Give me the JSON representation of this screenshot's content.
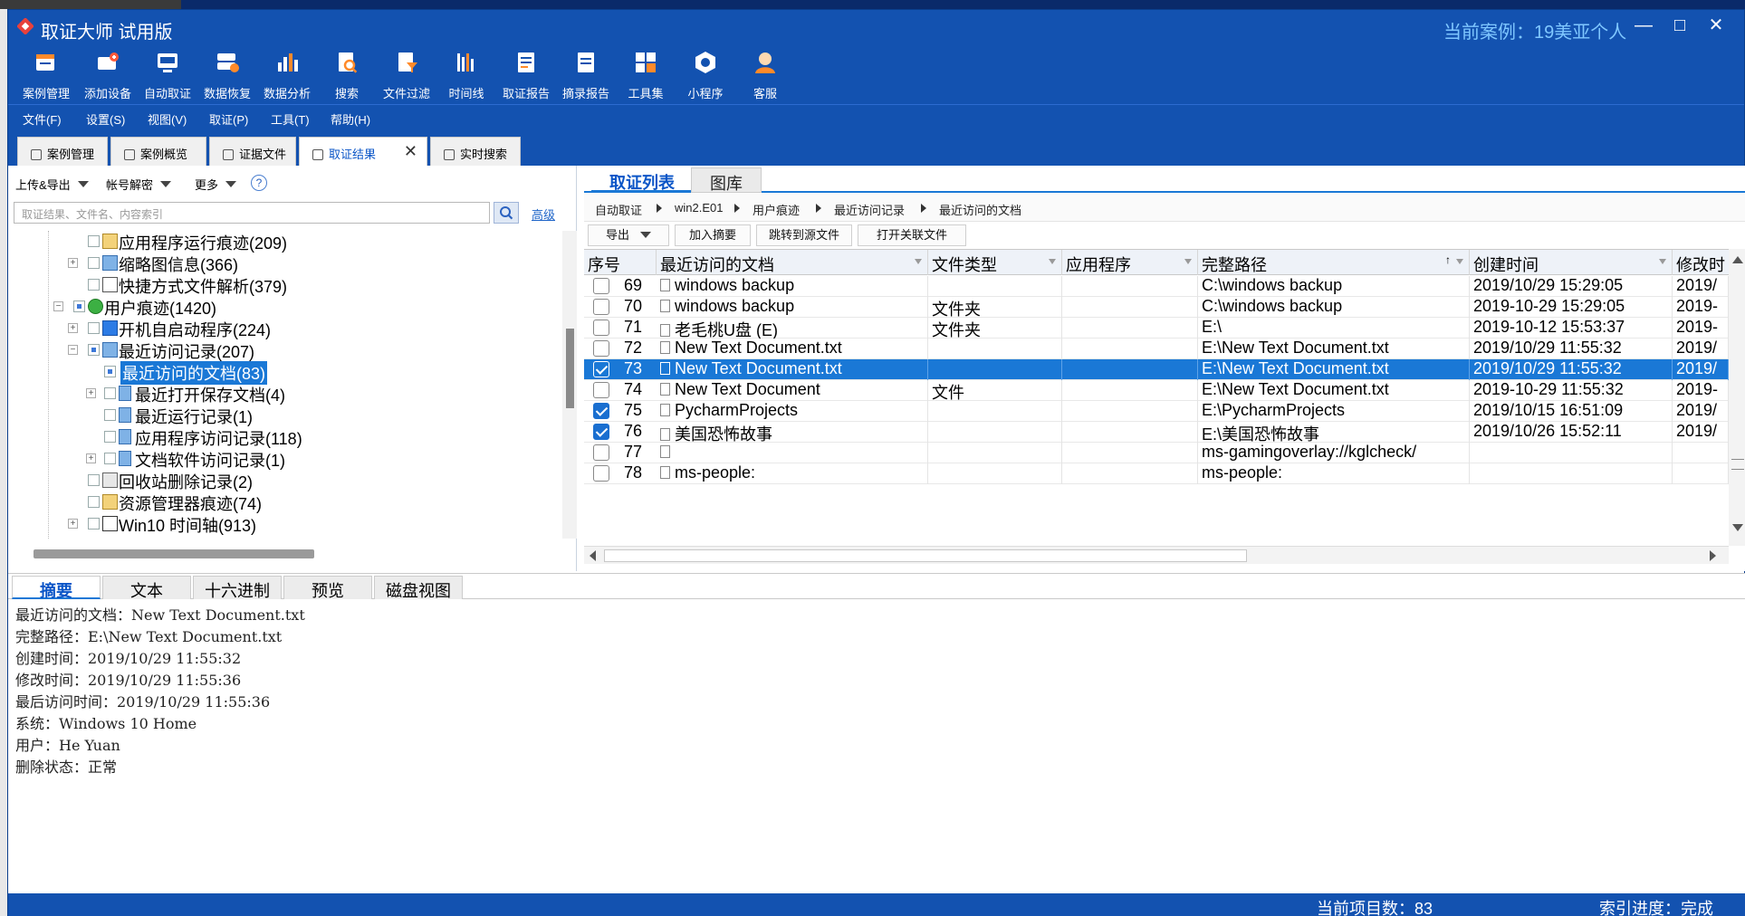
{
  "app": {
    "title": "取证大师 试用版",
    "current_case": "当前案例：19美亚个人",
    "brand_color": "#1352b0",
    "accent_color": "#1a78d6"
  },
  "window_controls": {
    "minimize": "—",
    "maximize": "□",
    "close": "✕"
  },
  "toolbar": [
    {
      "label": "案例管理",
      "icon": "case-manage-icon"
    },
    {
      "label": "添加设备",
      "icon": "add-device-icon"
    },
    {
      "label": "自动取证",
      "icon": "auto-forensics-icon"
    },
    {
      "label": "数据恢复",
      "icon": "data-recovery-icon"
    },
    {
      "label": "数据分析",
      "icon": "data-analysis-icon"
    },
    {
      "label": "搜索",
      "icon": "search-doc-icon"
    },
    {
      "label": "文件过滤",
      "icon": "file-filter-icon"
    },
    {
      "label": "时间线",
      "icon": "timeline-icon"
    },
    {
      "label": "取证报告",
      "icon": "forensic-report-icon"
    },
    {
      "label": "摘录报告",
      "icon": "excerpt-report-icon"
    },
    {
      "label": "工具集",
      "icon": "toolset-icon"
    },
    {
      "label": "小程序",
      "icon": "mini-program-icon"
    },
    {
      "label": "客服",
      "icon": "customer-service-icon"
    }
  ],
  "menu": [
    "文件(F)",
    "设置(S)",
    "视图(V)",
    "取证(P)",
    "工具(T)",
    "帮助(H)"
  ],
  "doc_tabs": [
    {
      "label": "案例管理"
    },
    {
      "label": "案例概览"
    },
    {
      "label": "证据文件"
    },
    {
      "label": "取证结果",
      "active": true
    },
    {
      "label": "实时搜索"
    }
  ],
  "left": {
    "dropdowns": [
      "上传&导出",
      "帐号解密",
      "更多"
    ],
    "help": "?",
    "search_placeholder": "取证结果、文件名、内容索引",
    "advanced_link": "高级",
    "tree": [
      {
        "label": "应用程序运行痕迹(209)"
      },
      {
        "label": "缩略图信息(366)"
      },
      {
        "label": "快捷方式文件解析(379)"
      },
      {
        "label": "用户痕迹(1420)"
      },
      {
        "label": "开机自启动程序(224)"
      },
      {
        "label": "最近访问记录(207)"
      },
      {
        "label": "最近访问的文档(83)",
        "selected": true
      },
      {
        "label": "最近打开保存文档(4)"
      },
      {
        "label": "最近运行记录(1)"
      },
      {
        "label": "应用程序访问记录(118)"
      },
      {
        "label": "文档软件访问记录(1)"
      },
      {
        "label": "回收站删除记录(2)"
      },
      {
        "label": "资源管理器痕迹(74)"
      },
      {
        "label": "Win10 时间轴(913)"
      }
    ]
  },
  "right": {
    "tabs": [
      "取证列表",
      "图库"
    ],
    "breadcrumb": [
      "自动取证",
      "win2.E01",
      "用户痕迹",
      "最近访问记录",
      "最近访问的文档"
    ],
    "actions": [
      "导出",
      "加入摘要",
      "跳转到源文件",
      "打开关联文件"
    ],
    "columns": [
      "序号",
      "最近访问的文档",
      "文件类型",
      "应用程序",
      "完整路径",
      "创建时间",
      "修改时"
    ],
    "rows": [
      {
        "num": "69",
        "name": "windows backup",
        "type": "",
        "app": "",
        "path": "C:\\windows backup",
        "created": "2019/10/29 15:29:05",
        "modified": "2019/",
        "checked": false,
        "selected": false
      },
      {
        "num": "70",
        "name": "windows backup",
        "type": "文件夹",
        "app": "",
        "path": "C:\\windows backup",
        "created": "2019-10-29 15:29:05",
        "modified": "2019-",
        "checked": false,
        "selected": false
      },
      {
        "num": "71",
        "name": "老毛桃U盘 (E)",
        "type": "文件夹",
        "app": "",
        "path": "E:\\",
        "created": "2019-10-12 15:53:37",
        "modified": "2019-",
        "checked": false,
        "selected": false
      },
      {
        "num": "72",
        "name": "New Text Document.txt",
        "type": "",
        "app": "",
        "path": "E:\\New Text Document.txt",
        "created": "2019/10/29 11:55:32",
        "modified": "2019/",
        "checked": false,
        "selected": false
      },
      {
        "num": "73",
        "name": "New Text Document.txt",
        "type": "",
        "app": "",
        "path": "E:\\New Text Document.txt",
        "created": "2019/10/29 11:55:32",
        "modified": "2019/",
        "checked": true,
        "selected": true
      },
      {
        "num": "74",
        "name": "New Text Document",
        "type": "文件",
        "app": "",
        "path": "E:\\New Text Document.txt",
        "created": "2019-10-29 11:55:32",
        "modified": "2019-",
        "checked": false,
        "selected": false
      },
      {
        "num": "75",
        "name": "PycharmProjects",
        "type": "",
        "app": "",
        "path": "E:\\PycharmProjects",
        "created": "2019/10/15 16:51:09",
        "modified": "2019/",
        "checked": true,
        "selected": false
      },
      {
        "num": "76",
        "name": "美国恐怖故事",
        "type": "",
        "app": "",
        "path": "E:\\美国恐怖故事",
        "created": "2019/10/26 15:52:11",
        "modified": "2019/",
        "checked": true,
        "selected": false
      },
      {
        "num": "77",
        "name": "",
        "type": "",
        "app": "",
        "path": "ms-gamingoverlay://kglcheck/",
        "created": "",
        "modified": "",
        "checked": false,
        "selected": false
      },
      {
        "num": "78",
        "name": "ms-people:",
        "type": "",
        "app": "",
        "path": "ms-people:",
        "created": "",
        "modified": "",
        "checked": false,
        "selected": false
      }
    ]
  },
  "detail": {
    "tabs": [
      "摘要",
      "文本",
      "十六进制",
      "预览",
      "磁盘视图"
    ],
    "lines": [
      "最近访问的文档：New Text Document.txt",
      "完整路径：E:\\New Text Document.txt",
      "创建时间：2019/10/29 11:55:32",
      "修改时间：2019/10/29 11:55:36",
      "最后访问时间：2019/10/29 11:55:36",
      "系统：Windows 10 Home",
      "用户：He Yuan",
      "删除状态：正常"
    ]
  },
  "status": {
    "count": "当前项目数：83",
    "index": "索引进度：完成"
  }
}
